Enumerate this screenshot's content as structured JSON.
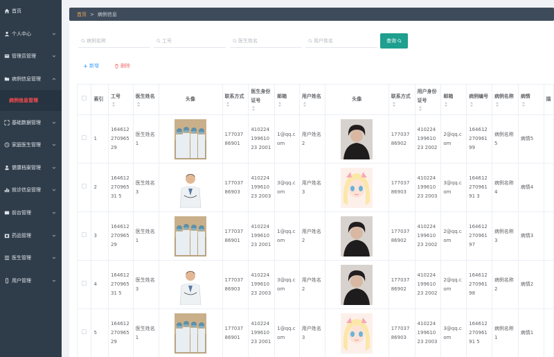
{
  "sidebar": {
    "items": [
      {
        "label": "首页",
        "icon": "home-icon",
        "arrow": false
      },
      {
        "label": "个人中心",
        "icon": "user-icon",
        "arrow": true
      },
      {
        "label": "管理员管理",
        "icon": "admin-icon",
        "arrow": true
      },
      {
        "label": "病例信息管理",
        "icon": "folder-icon",
        "arrow": true
      },
      {
        "label": "病例信息管理",
        "icon": "",
        "arrow": false,
        "active": true
      },
      {
        "label": "基础数据管理",
        "icon": "expand-icon",
        "arrow": true
      },
      {
        "label": "家庭医生管理",
        "icon": "clock-icon",
        "arrow": true
      },
      {
        "label": "健康档案管理",
        "icon": "record-icon",
        "arrow": true
      },
      {
        "label": "就诊信息管理",
        "icon": "chart-icon",
        "arrow": true
      },
      {
        "label": "前台管理",
        "icon": "desk-icon",
        "arrow": true
      },
      {
        "label": "药品管理",
        "icon": "medicine-icon",
        "arrow": true
      },
      {
        "label": "医生管理",
        "icon": "doctor-icon",
        "arrow": true
      },
      {
        "label": "用户管理",
        "icon": "phone-icon",
        "arrow": true
      }
    ]
  },
  "breadcrumb": {
    "home": "首页",
    "separator": ">",
    "current": "病例信息"
  },
  "search": {
    "case_name_placeholder": "病例名称",
    "job_no_placeholder": "工号",
    "doctor_name_placeholder": "医生姓名",
    "user_name_placeholder": "用户姓名",
    "query_label": "查询"
  },
  "actions": {
    "add_label": "新增",
    "delete_label": "删除"
  },
  "table": {
    "headers": {
      "index": "索引",
      "job_no": "工号",
      "doctor_name": "医生姓名",
      "doctor_avatar": "头像",
      "doctor_phone": "联系方式",
      "doctor_id": "医生身份证号",
      "doctor_email": "邮箱",
      "user_name": "用户姓名",
      "user_avatar": "头像",
      "user_phone": "联系方式",
      "user_id": "用户身份证号",
      "user_email": "邮箱",
      "case_no": "病例编号",
      "case_name": "病例名称",
      "condition": "病情",
      "extra": "描"
    },
    "rows": [
      {
        "index": "1",
        "job_no": "16461227096529",
        "doctor_name": "医生姓名1",
        "doctor_avatar": "group",
        "doctor_phone": "17703786901",
        "doctor_id": "41022419961023 2001",
        "doctor_email": "1@qq.com",
        "user_name": "用户姓名2",
        "user_avatar": "man",
        "user_phone": "17703786902",
        "user_id": "41022419961023 2002",
        "user_email": "2@qq.com",
        "case_no": "16461227096199",
        "case_name": "病例名称5",
        "condition": "病情5"
      },
      {
        "index": "2",
        "job_no": "16461227096531 5",
        "doctor_name": "医生姓名3",
        "doctor_avatar": "doctor",
        "doctor_phone": "17703786903",
        "doctor_id": "41022419961023 2003",
        "doctor_email": "3@qq.com",
        "user_name": "用户姓名3",
        "user_avatar": "anime",
        "user_phone": "17703786903",
        "user_id": "41022419961023 2003",
        "user_email": "3@qq.com",
        "case_no": "16461227096191 3",
        "case_name": "病例名称4",
        "condition": "病情4"
      },
      {
        "index": "3",
        "job_no": "16461227096529",
        "doctor_name": "医生姓名1",
        "doctor_avatar": "group",
        "doctor_phone": "17703786901",
        "doctor_id": "41022419961023 2001",
        "doctor_email": "1@qq.com",
        "user_name": "用户姓名2",
        "user_avatar": "man",
        "user_phone": "17703786902",
        "user_id": "41022419961023 2002",
        "user_email": "2@qq.com",
        "case_no": "16461227096197",
        "case_name": "病例名称3",
        "condition": "病情3"
      },
      {
        "index": "4",
        "job_no": "16461227096531 5",
        "doctor_name": "医生姓名3",
        "doctor_avatar": "doctor",
        "doctor_phone": "17703786903",
        "doctor_id": "41022419961023 2003",
        "doctor_email": "3@qq.com",
        "user_name": "用户姓名2",
        "user_avatar": "man",
        "user_phone": "17703786902",
        "user_id": "41022419961023 2002",
        "user_email": "2@qq.com",
        "case_no": "16461227096198",
        "case_name": "病例名称2",
        "condition": "病情2"
      },
      {
        "index": "5",
        "job_no": "16461227096529",
        "doctor_name": "医生姓名1",
        "doctor_avatar": "group",
        "doctor_phone": "17703786901",
        "doctor_id": "41022419961023 2001",
        "doctor_email": "1@qq.com",
        "user_name": "用户姓名3",
        "user_avatar": "anime",
        "user_phone": "17703786903",
        "user_id": "41022419961023 2003",
        "user_email": "3@qq.com",
        "case_no": "16461227096191 5",
        "case_name": "病例名称1",
        "condition": "病情1"
      }
    ]
  },
  "colors": {
    "sidebar": "#2f3d4a",
    "breadcrumb": "#3e4b5a",
    "accent": "#1e9f8f",
    "active_menu": "#ff4d4f",
    "add": "#409eff",
    "delete": "#f56c6c"
  }
}
